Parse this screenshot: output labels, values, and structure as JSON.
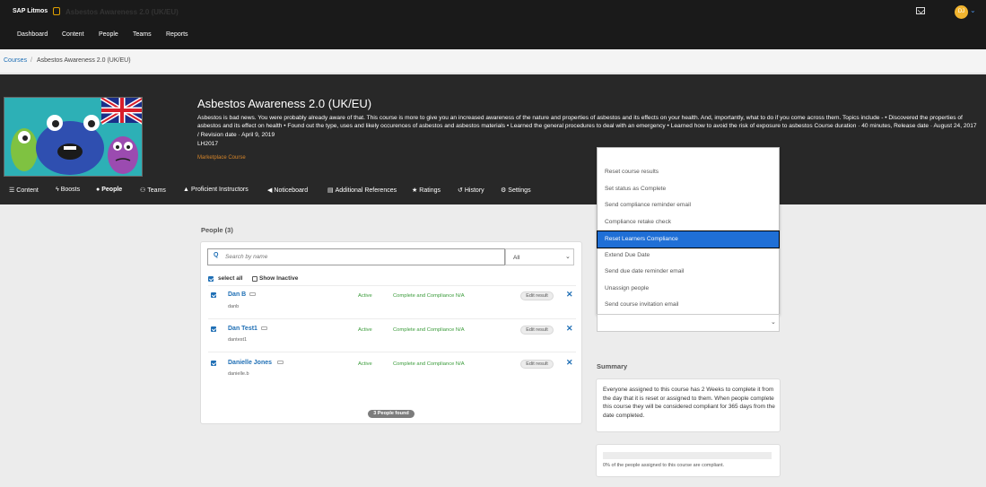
{
  "topbar": {
    "brand": "SAP Litmos",
    "app_title": "Asbestos Awareness 2.0 (UK/EU)",
    "nav": [
      "Dashboard",
      "Content",
      "People",
      "Teams",
      "Reports"
    ],
    "avatar_initials": "DJ",
    "accent_color": "#f1b42f"
  },
  "breadcrumb": {
    "courses": "Courses",
    "separator": "/",
    "current": "Asbestos Awareness 2.0 (UK/EU)"
  },
  "course": {
    "title": "Asbestos Awareness 2.0 (UK/EU)",
    "description": "Asbestos is bad news. You were probably already aware of that. This course is more to give you an increased awareness of the nature and properties of asbestos and its effects on your health. And, importantly, what to do if you come across them. Topics include - • Discovered the properties of asbestos and its effect on health • Found out the type, uses and likely occurences of asbestos and asbestos materials • Learned the general procedures to deal with an emergency • Learned how to avoid the risk of exposure to asbestos Course duration · 40 minutes, Release date · August 24, 2017 / Revision date · April 9, 2019",
    "code": "LH2017",
    "marketplace": "Marketplace Course"
  },
  "tabs": [
    {
      "label": "Content",
      "icon": "list-icon"
    },
    {
      "label": "Boosts",
      "icon": "bolt-icon"
    },
    {
      "label": "People",
      "icon": "person-icon"
    },
    {
      "label": "Teams",
      "icon": "group-icon"
    },
    {
      "label": "Proficient Instructors",
      "icon": "graduation-cap-icon"
    },
    {
      "label": "Noticeboard",
      "icon": "megaphone-icon"
    },
    {
      "label": "Additional References",
      "icon": "document-icon"
    },
    {
      "label": "Ratings",
      "icon": "star-icon"
    },
    {
      "label": "History",
      "icon": "history-icon"
    },
    {
      "label": "Settings",
      "icon": "gear-icon"
    }
  ],
  "people": {
    "heading": "People (3)",
    "search_placeholder": "Search by name",
    "filter_value": "All",
    "select_all": "select all",
    "show_inactive": "Show Inactive",
    "rows": [
      {
        "name": "Dan B",
        "username": "danb",
        "status": "Active",
        "compliance": "Complete and Compliance N/A",
        "edit_label": "Edit result"
      },
      {
        "name": "Dan Test1",
        "username": "dantest1",
        "status": "Active",
        "compliance": "Complete and Compliance N/A",
        "edit_label": "Edit result"
      },
      {
        "name": "Danielle Jones",
        "username": "danielle.b",
        "status": "Active",
        "compliance": "Complete and Compliance N/A",
        "edit_label": "Edit result"
      }
    ],
    "found": "3 People found"
  },
  "menu": {
    "items": [
      "Reset course results",
      "Set status as Complete",
      "Send compliance reminder email",
      "Compliance retake check",
      "Reset Learners Compliance",
      "Extend Due Date",
      "Send due date reminder email",
      "Unassign people",
      "Send course invitation email"
    ],
    "highlighted_index": 4,
    "highlight_color": "#1f6fd6"
  },
  "summary": {
    "heading": "Summary",
    "text": "Everyone assigned to this course has 2 Weeks to complete it from the day that it is reset or assigned to them. When people complete this course they will be considered compliant for 365 days from the date completed.",
    "compliance_percent": 0,
    "compliance_text": "0% of the people assigned to this course are compliant."
  }
}
